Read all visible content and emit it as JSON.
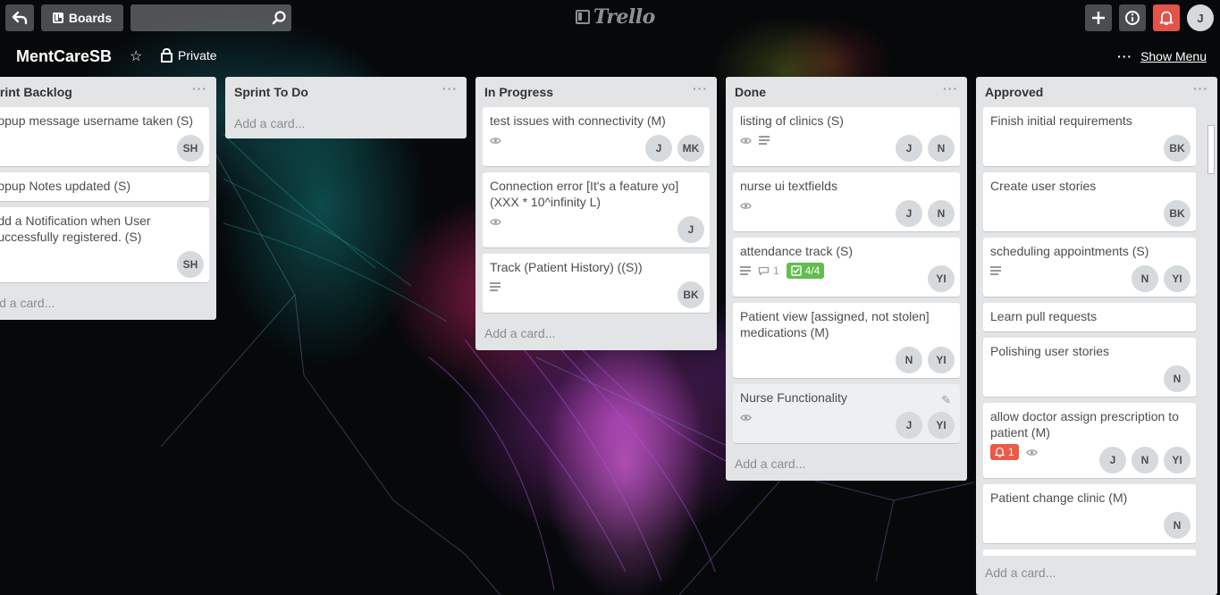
{
  "header": {
    "back_icon": "back-arrow-icon",
    "boards_label": "Boards",
    "search_value": "",
    "search_placeholder": "",
    "logo_text": "Trello",
    "avatar_initial": "J",
    "notification_color": "#e2534a"
  },
  "board": {
    "title": "MentCareSB",
    "star_icon": "☆",
    "privacy_label": "Private",
    "menu_dots": "···",
    "show_menu_label": "Show Menu"
  },
  "lists": [
    {
      "title": "Sprint Backlog",
      "menu": "···",
      "add_card": "Add a card...",
      "cards": [
        {
          "title": "Popup message username taken (S)",
          "members": [
            "SH"
          ]
        },
        {
          "title": "Popup Notes updated (S)",
          "members": []
        },
        {
          "title": "Add a Notification when User Successfully registered. (S)",
          "members": [
            "SH"
          ]
        }
      ]
    },
    {
      "title": "Sprint To Do",
      "menu": "···",
      "add_card": "Add a card...",
      "cards": []
    },
    {
      "title": "In Progress",
      "menu": "···",
      "add_card": "Add a card...",
      "cards": [
        {
          "title": "test issues with connectivity (M)",
          "members": [
            "J",
            "MK"
          ]
        },
        {
          "title": "Connection error [It's a feature yo] (XXX * 10^infinity L)",
          "members": [
            "J"
          ]
        },
        {
          "title": "Track (Patient History) ((S))",
          "members": [
            "BK"
          ]
        }
      ]
    },
    {
      "title": "Done",
      "menu": "···",
      "add_card": "Add a card...",
      "cards": [
        {
          "title": "listing of clinics (S)",
          "members": [
            "J",
            "N"
          ]
        },
        {
          "title": "nurse ui textfields",
          "members": [
            "J",
            "N"
          ]
        },
        {
          "title": "attendance track (S)",
          "comments": "1",
          "checklist": "4/4",
          "members": [
            "YI"
          ]
        },
        {
          "title": "Patient view [assigned, not stolen] medications (M)",
          "members": [
            "N",
            "YI"
          ]
        },
        {
          "title": "Nurse Functionality",
          "members": [
            "J",
            "YI"
          ]
        }
      ]
    },
    {
      "title": "Approved",
      "menu": "···",
      "add_card": "Add a card...",
      "cards": [
        {
          "title": "Finish initial requirements",
          "members": [
            "BK"
          ]
        },
        {
          "title": "Create user stories",
          "members": [
            "BK"
          ]
        },
        {
          "title": "scheduling appointments (S)",
          "members": [
            "N",
            "YI"
          ]
        },
        {
          "title": "Learn pull requests",
          "members": []
        },
        {
          "title": "Polishing user stories",
          "members": [
            "N"
          ]
        },
        {
          "title": "allow doctor assign prescription to patient (M)",
          "alerts": "1",
          "members": [
            "J",
            "N",
            "YI"
          ]
        },
        {
          "title": "Patient change clinic (M)",
          "members": [
            "N"
          ]
        }
      ]
    }
  ]
}
